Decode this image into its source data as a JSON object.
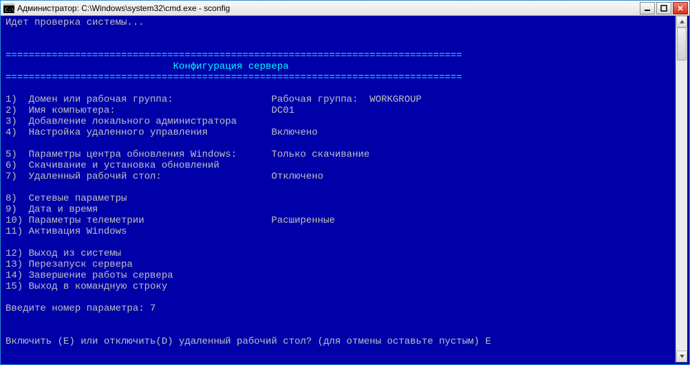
{
  "window": {
    "title": "Администратор: C:\\Windows\\system32\\cmd.exe - sconfig"
  },
  "console": {
    "status": "Идет проверка системы...",
    "divider": "===============================================================================",
    "header": "                             Конфигурация сервера",
    "items": [
      {
        "n": "1)",
        "label": "Домен или рабочая группа:",
        "value": "Рабочая группа:  WORKGROUP"
      },
      {
        "n": "2)",
        "label": "Имя компьютера:",
        "value": "DC01"
      },
      {
        "n": "3)",
        "label": "Добавление локального администратора",
        "value": ""
      },
      {
        "n": "4)",
        "label": "Настройка удаленного управления",
        "value": "Включено"
      },
      {
        "n": "",
        "label": "",
        "value": ""
      },
      {
        "n": "5)",
        "label": "Параметры центра обновления Windows:",
        "value": "Только скачивание"
      },
      {
        "n": "6)",
        "label": "Скачивание и установка обновлений",
        "value": ""
      },
      {
        "n": "7)",
        "label": "Удаленный рабочий стол:",
        "value": "Отключено"
      },
      {
        "n": "",
        "label": "",
        "value": ""
      },
      {
        "n": "8)",
        "label": "Сетевые параметры",
        "value": ""
      },
      {
        "n": "9)",
        "label": "Дата и время",
        "value": ""
      },
      {
        "n": "10)",
        "label": "Параметры телеметрии",
        "value": "Расширенные"
      },
      {
        "n": "11)",
        "label": "Активация Windows",
        "value": ""
      },
      {
        "n": "",
        "label": "",
        "value": ""
      },
      {
        "n": "12)",
        "label": "Выход из системы",
        "value": ""
      },
      {
        "n": "13)",
        "label": "Перезапуск сервера",
        "value": ""
      },
      {
        "n": "14)",
        "label": "Завершение работы сервера",
        "value": ""
      },
      {
        "n": "15)",
        "label": "Выход в командную строку",
        "value": ""
      }
    ],
    "prompt_label": "Введите номер параметра: ",
    "prompt_value": "7",
    "rds_prompt_label": "Включить (E) или отключить(D) удаленный рабочий стол? (для отмены оставьте пустым) ",
    "rds_prompt_value": "E"
  }
}
